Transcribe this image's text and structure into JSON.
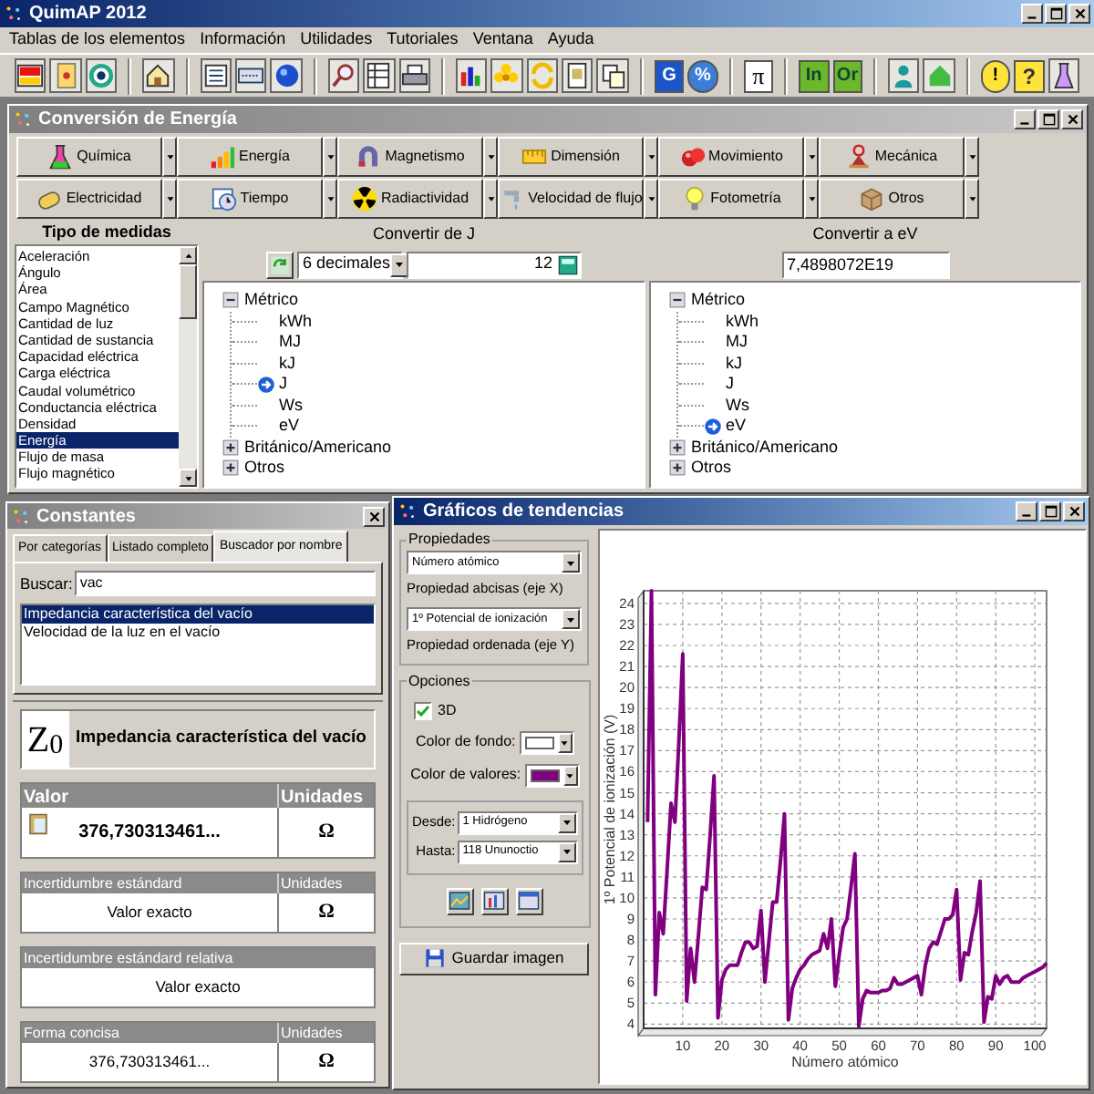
{
  "app": {
    "title": "QuimAP 2012"
  },
  "menu": [
    "Tablas de los elementos",
    "Información",
    "Utilidades",
    "Tutoriales",
    "Ventana",
    "Ayuda"
  ],
  "toolbar_texts": [
    "G",
    "%",
    "π",
    "In",
    "Or",
    "!",
    "?"
  ],
  "conversion": {
    "title": "Conversión de Energía",
    "categories": [
      "Química",
      "Energía",
      "Magnetismo",
      "Dimensión",
      "Movimiento",
      "Mecánica",
      "Electricidad",
      "Tiempo",
      "Radiactividad",
      "Velocidad de flujo",
      "Fotometría",
      "Otros"
    ],
    "measures": {
      "title": "Tipo de medidas",
      "items": [
        {
          "label": "Aceleración",
          "selected": false
        },
        {
          "label": "Ángulo",
          "selected": false
        },
        {
          "label": "Área",
          "selected": false
        },
        {
          "label": "Campo Magnético",
          "selected": false
        },
        {
          "label": "Cantidad de luz",
          "selected": false
        },
        {
          "label": "Cantidad de sustancia",
          "selected": false
        },
        {
          "label": "Capacidad eléctrica",
          "selected": false
        },
        {
          "label": "Carga eléctrica",
          "selected": false
        },
        {
          "label": "Caudal volumétrico",
          "selected": false
        },
        {
          "label": "Conductancia eléctrica",
          "selected": false
        },
        {
          "label": "Densidad",
          "selected": false
        },
        {
          "label": "Energía",
          "selected": true
        },
        {
          "label": "Flujo de masa",
          "selected": false
        },
        {
          "label": "Flujo magnético",
          "selected": false
        }
      ]
    },
    "from": {
      "title": "Convertir de J",
      "decimals": "6 decimales",
      "value": "12",
      "tree": [
        {
          "label": "Métrico",
          "expanded": true,
          "selected": false,
          "children": [
            {
              "label": "kWh",
              "selected": false
            },
            {
              "label": "MJ",
              "selected": false
            },
            {
              "label": "kJ",
              "selected": false
            },
            {
              "label": "J",
              "selected": true
            },
            {
              "label": "Ws",
              "selected": false
            },
            {
              "label": "eV",
              "selected": false
            }
          ]
        },
        {
          "label": "Británico/Americano",
          "expanded": false,
          "selected": false
        },
        {
          "label": "Otros",
          "expanded": false,
          "selected": false
        }
      ]
    },
    "to": {
      "title": "Convertir a eV",
      "value": "7,4898072E19",
      "tree": [
        {
          "label": "Métrico",
          "expanded": true,
          "selected": false,
          "children": [
            {
              "label": "kWh",
              "selected": false
            },
            {
              "label": "MJ",
              "selected": false
            },
            {
              "label": "kJ",
              "selected": false
            },
            {
              "label": "J",
              "selected": false
            },
            {
              "label": "Ws",
              "selected": false
            },
            {
              "label": "eV",
              "selected": true
            }
          ]
        },
        {
          "label": "Británico/Americano",
          "expanded": false,
          "selected": false
        },
        {
          "label": "Otros",
          "expanded": false,
          "selected": false
        }
      ]
    }
  },
  "constants": {
    "title": "Constantes",
    "tabs": [
      {
        "label": "Por categorías",
        "selected": false
      },
      {
        "label": "Listado completo",
        "selected": false
      },
      {
        "label": "Buscador por nombre",
        "selected": true
      }
    ],
    "search": {
      "label": "Buscar:",
      "value": "vac"
    },
    "results": [
      {
        "label": "Impedancia característica del vacío",
        "selected": true
      },
      {
        "label": "Velocidad de la luz en el vacío",
        "selected": false
      }
    ],
    "detail": {
      "symbol": "Z$_{0}$",
      "name": "Impedancia característica del vacío",
      "rows": [
        {
          "kind": "main",
          "header": "Valor",
          "units_header": "Unidades",
          "value": "376,730313461...",
          "units": "Ω"
        },
        {
          "kind": "plain",
          "header": "Incertidumbre estándard",
          "units_header": "Unidades",
          "value": "Valor exacto",
          "units": "Ω"
        },
        {
          "kind": "plain",
          "header": "Incertidumbre estándard relativa",
          "value": "Valor exacto"
        },
        {
          "kind": "plain",
          "header": "Forma concisa",
          "units_header": "Unidades",
          "value": "376,730313461...",
          "units": "Ω"
        }
      ]
    }
  },
  "trends": {
    "title": "Gráficos de tendencias",
    "properties": {
      "title": "Propiedades",
      "x_select": "Número atómico",
      "x_label": "Propiedad abcisas (eje X)",
      "y_select": "1º Potencial de ionización",
      "y_label": "Propiedad ordenada (eje Y)"
    },
    "options": {
      "title": "Opciones",
      "three_d": {
        "label": "3D",
        "checked": true
      },
      "background": {
        "label": "Color de fondo:",
        "color": "#ffffff"
      },
      "values_color": {
        "label": "Color de valores:",
        "color": "#800080"
      },
      "from": {
        "label": "Desde:",
        "value": "1 Hidrógeno"
      },
      "to": {
        "label": "Hasta:",
        "value": "118 Ununoctio"
      }
    },
    "save_button": "Guardar imagen",
    "chart_data": {
      "type": "line",
      "xlabel": "Número atómico",
      "ylabel": "1º Potencial de ionización (V)",
      "x": [
        1,
        2,
        3,
        4,
        5,
        6,
        7,
        8,
        9,
        10,
        11,
        12,
        13,
        14,
        15,
        16,
        17,
        18,
        19,
        20,
        21,
        22,
        23,
        24,
        25,
        26,
        27,
        28,
        29,
        30,
        31,
        32,
        33,
        34,
        35,
        36,
        37,
        38,
        39,
        40,
        41,
        42,
        43,
        44,
        45,
        46,
        47,
        48,
        49,
        50,
        51,
        52,
        53,
        54,
        55,
        56,
        57,
        58,
        59,
        60,
        61,
        62,
        63,
        64,
        65,
        66,
        67,
        68,
        69,
        70,
        71,
        72,
        73,
        74,
        75,
        76,
        77,
        78,
        79,
        80,
        81,
        82,
        83,
        84,
        85,
        86,
        87,
        88,
        89,
        90,
        91,
        92,
        93,
        94,
        95,
        96,
        97,
        98,
        99,
        100,
        101,
        102,
        103
      ],
      "series": [
        {
          "color": "#800080",
          "values": [
            13.6,
            24.6,
            5.4,
            9.3,
            8.3,
            11.3,
            14.5,
            13.6,
            17.4,
            21.6,
            5.1,
            7.6,
            6.0,
            8.2,
            10.5,
            10.4,
            13.0,
            15.8,
            4.3,
            6.1,
            6.6,
            6.8,
            6.8,
            6.8,
            7.4,
            7.9,
            7.9,
            7.6,
            7.7,
            9.4,
            6.0,
            7.9,
            9.8,
            9.8,
            11.8,
            14.0,
            4.2,
            5.7,
            6.2,
            6.6,
            6.8,
            7.1,
            7.3,
            7.4,
            7.5,
            8.3,
            7.6,
            9.0,
            5.8,
            7.3,
            8.6,
            9.0,
            10.5,
            12.1,
            3.9,
            5.2,
            5.6,
            5.5,
            5.5,
            5.5,
            5.6,
            5.6,
            5.7,
            6.2,
            5.9,
            5.9,
            6.0,
            6.1,
            6.2,
            6.3,
            5.4,
            6.8,
            7.6,
            7.9,
            7.8,
            8.4,
            9.0,
            9.0,
            9.2,
            10.4,
            6.1,
            7.4,
            7.3,
            8.4,
            9.3,
            10.8,
            4.1,
            5.3,
            5.2,
            6.3,
            5.9,
            6.2,
            6.3,
            6.0,
            6.0,
            6.0,
            6.2,
            6.3,
            6.4,
            6.5,
            6.6,
            6.7,
            6.9
          ]
        }
      ],
      "xlim": [
        0,
        103
      ],
      "ylim": [
        3.8,
        24.6
      ],
      "grid": true,
      "xticks": [
        10,
        20,
        30,
        40,
        50,
        60,
        70,
        80,
        90,
        100
      ],
      "yticks": [
        4,
        5,
        6,
        7,
        8,
        9,
        10,
        11,
        12,
        13,
        14,
        15,
        16,
        17,
        18,
        19,
        20,
        21,
        22,
        23,
        24
      ]
    }
  }
}
